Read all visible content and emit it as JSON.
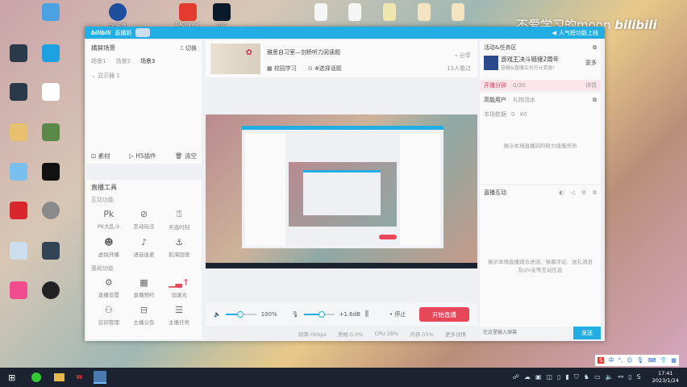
{
  "watermark": "不爱学习的moon",
  "watermark_logo": "bilibili",
  "desktop": {
    "top_icons": [
      "QQ影音",
      "CAJViewer",
      "知云"
    ]
  },
  "window": {
    "logo": "bilibili",
    "app_name": "直播姬",
    "notice": "人气榜功能上线",
    "left": {
      "scene_title": "横屏场景",
      "switch": "切换",
      "scene_tabs": [
        "场景1",
        "场景2",
        "场景3"
      ],
      "source": "显示器 1",
      "actions": [
        "素材",
        "H5插件",
        "清空"
      ],
      "tools_title": "直播工具",
      "interactive_title": "互动功能",
      "interactive": [
        "PK大乱斗",
        "互动玩法",
        "天选时刻",
        "虚拟开播",
        "语音连麦",
        "航海回馈"
      ],
      "basic_title": "基础功能",
      "basic": [
        "直播设置",
        "直播预约",
        "加速光",
        "房间管理",
        "主播公告",
        "主播任务"
      ]
    },
    "center": {
      "room_title": "雅思自习室—剑桥听力阅读题",
      "category": "校园学习",
      "topic": "#选择话题",
      "share": "分享",
      "watched": "13人看过",
      "volume": "100%",
      "mic_gain": "+1.6dB",
      "stop": "停止",
      "start": "开始直播",
      "status": [
        "码率:0kbps",
        "丢帧:0.0%",
        "CPU:28%",
        "内存:55%",
        "更多详情"
      ]
    },
    "right": {
      "activity_title": "活动&任务区",
      "event_title": "游戏王决斗链接2周年",
      "event_sub": "投稿&直播瓜分万元奖励!",
      "more": "更多",
      "score_label": "开播分钟",
      "score": "0/30",
      "details": "详情",
      "users_title": "高能用户",
      "gifts": "礼物流水",
      "stats_label": "本场数据",
      "stats_a": "0",
      "stats_b": "¥0",
      "users_empty": "展示本场直播间的粉力值服务员",
      "interact_title": "直播互动",
      "interact_empty": "展示本场直播观众进场、弹幕评论、送礼消息及shi关等互动信息",
      "chat_placeholder": "在这里输入弹幕",
      "send": "发送"
    }
  },
  "taskbar": {
    "time": "17:41",
    "date": "2023/1/24",
    "ime": "中"
  }
}
